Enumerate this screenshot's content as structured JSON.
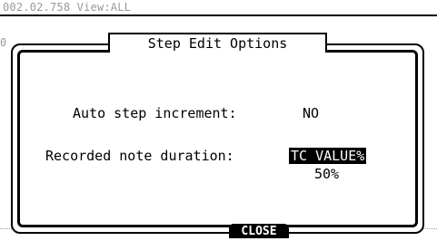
{
  "status_bar": {
    "text": "002.02.758 View:ALL"
  },
  "dialog": {
    "title": "Step Edit Options",
    "auto_step": {
      "label": "Auto step increment:",
      "value": "NO"
    },
    "note_duration": {
      "label": "Recorded note duration:",
      "selected_value": "TC VALUE%",
      "secondary_value": "50%"
    },
    "close_label": "CLOSE"
  },
  "background": {
    "left_marker": "0"
  },
  "colors": {
    "foreground": "#000000",
    "background": "#ffffff",
    "dim_text": "#9a9a9a"
  }
}
